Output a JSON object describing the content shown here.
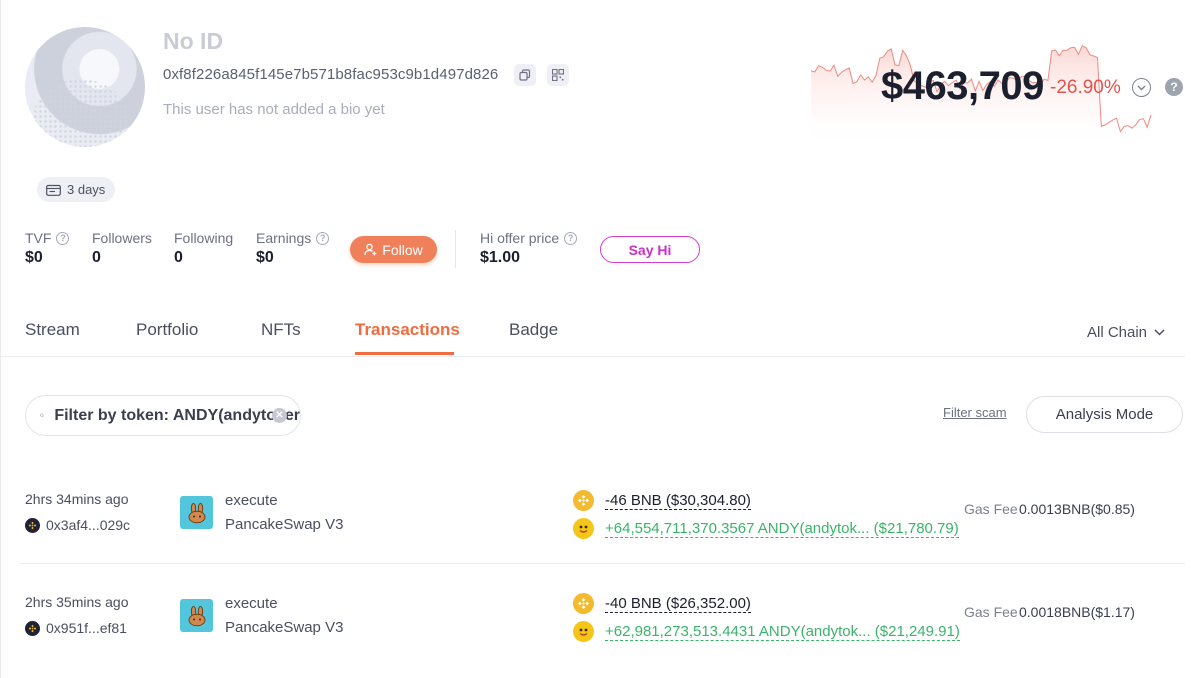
{
  "profile": {
    "name": "No ID",
    "address": "0xf8f226a845f145e7b571b8fac953c9b1d497d826",
    "bio": "This user has not added a bio yet",
    "age_badge": "3 days"
  },
  "portfolio": {
    "value": "$463,709",
    "change": "-26.90%",
    "help": "?",
    "colors": {
      "chart_fill": "#fde2e0",
      "chart_line": "#ef7a73",
      "negative": "#e5534b"
    }
  },
  "stats": {
    "tvf": {
      "label": "TVF",
      "value": "$0"
    },
    "followers": {
      "label": "Followers",
      "value": "0"
    },
    "following": {
      "label": "Following",
      "value": "0"
    },
    "earnings": {
      "label": "Earnings",
      "value": "$0"
    },
    "follow_label": "Follow",
    "hi_offer": {
      "label": "Hi offer price",
      "value": "$1.00"
    },
    "say_hi_label": "Say Hi"
  },
  "tabs": [
    {
      "label": "Stream"
    },
    {
      "label": "Portfolio"
    },
    {
      "label": "NFTs"
    },
    {
      "label": "Transactions",
      "active": true
    },
    {
      "label": "Badge"
    }
  ],
  "chain_filter": "All Chain",
  "filter": {
    "search_value": "Filter by token: ANDY(andytoker",
    "filter_scam": "Filter scam",
    "analysis_mode": "Analysis Mode"
  },
  "transactions": [
    {
      "time": "2hrs 34mins ago",
      "from": "0x3af4...029c",
      "method": "execute",
      "app": "PancakeSwap V3",
      "out": "-46 BNB ($30,304.80)",
      "in": "+64,554,711,370.3567 ANDY(andytok...   ($21,780.79)",
      "gas_label": "Gas Fee",
      "gas_value": "0.0013BNB($0.85)"
    },
    {
      "time": "2hrs 35mins ago",
      "from": "0x951f...ef81",
      "method": "execute",
      "app": "PancakeSwap V3",
      "out": "-40 BNB ($26,352.00)",
      "in": "+62,981,273,513.4431 ANDY(andytok...   ($21,249.91)",
      "gas_label": "Gas Fee",
      "gas_value": "0.0018BNB($1.17)"
    }
  ]
}
